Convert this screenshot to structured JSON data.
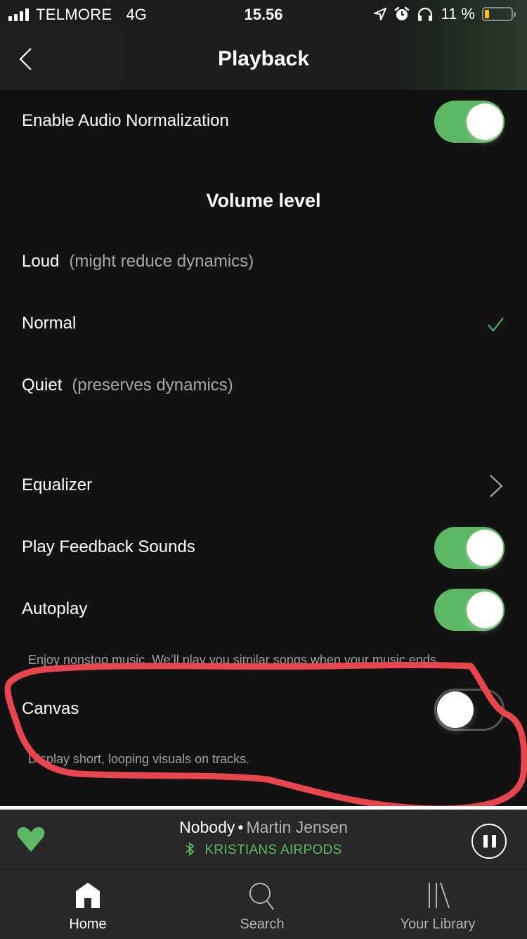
{
  "status_bar": {
    "carrier": "TELMORE",
    "network": "4G",
    "time": "15.56",
    "battery_percent_label": "11 %",
    "battery_level": 0.11,
    "icons": [
      "signal-icon",
      "location-icon",
      "alarm-icon",
      "headphones-icon",
      "battery-icon"
    ]
  },
  "header": {
    "title": "Playback",
    "back_icon": "chevron-left-icon"
  },
  "settings": {
    "audio_normalization": {
      "label": "Enable Audio Normalization",
      "enabled": true
    },
    "volume_level": {
      "title": "Volume level",
      "options": [
        {
          "label": "Loud",
          "hint": "(might reduce dynamics)",
          "selected": false
        },
        {
          "label": "Normal",
          "hint": "",
          "selected": true
        },
        {
          "label": "Quiet",
          "hint": "(preserves dynamics)",
          "selected": false
        }
      ]
    },
    "equalizer": {
      "label": "Equalizer"
    },
    "feedback_sounds": {
      "label": "Play Feedback Sounds",
      "enabled": true
    },
    "autoplay": {
      "label": "Autoplay",
      "enabled": true,
      "description": "Enjoy nonstop music. We’ll play you similar songs when your music ends."
    },
    "canvas": {
      "label": "Canvas",
      "enabled": false,
      "description": "Display short, looping visuals on tracks."
    }
  },
  "annotation": {
    "shape": "freehand-circle",
    "color": "#e8464f",
    "target": "canvas"
  },
  "now_playing": {
    "title": "Nobody",
    "separator": "•",
    "artist": "Martin Jensen",
    "device": "KRISTIANS AIRPODS",
    "liked": true,
    "state": "playing"
  },
  "tab_bar": {
    "tabs": [
      {
        "label": "Home",
        "icon": "home-icon",
        "active": true
      },
      {
        "label": "Search",
        "icon": "search-icon",
        "active": false
      },
      {
        "label": "Your Library",
        "icon": "library-icon",
        "active": false
      }
    ]
  },
  "colors": {
    "accent": "#5cb864",
    "background": "#121212",
    "player": "#282828",
    "battery": "#f5c518"
  }
}
